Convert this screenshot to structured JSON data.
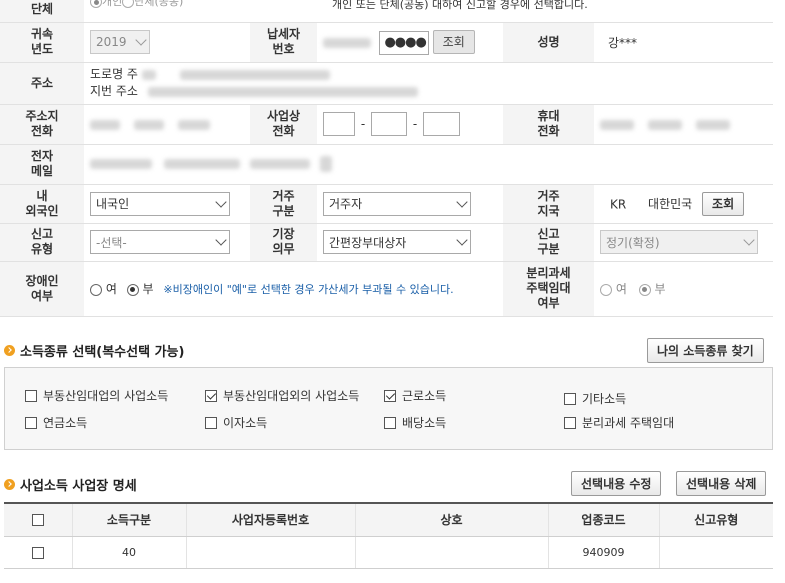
{
  "rows": {
    "group_type": {
      "label": "단체",
      "option_individual": "개인",
      "option_group": "단체(공동)",
      "note": "개인 또는 단체(공동) 대하여 신고할 경우에 선택합니다."
    },
    "tax_year": {
      "label": "귀속\n년도",
      "value": "2019"
    },
    "taxpayer_no": {
      "label": "납세자\n번호",
      "masked": "●●●●",
      "lookup_button": "조회"
    },
    "name": {
      "label": "성명",
      "value": "강***"
    },
    "address": {
      "label": "주소",
      "road_prefix": "도로명 주",
      "lot_prefix": "지번 주소"
    },
    "addr_phone": {
      "label": "주소지\n전화"
    },
    "biz_phone": {
      "label": "사업상\n전화",
      "sep": "-"
    },
    "mobile": {
      "label": "휴대\n전화"
    },
    "email": {
      "label": "전자\n메일"
    },
    "nationality": {
      "label": "내\n외국인",
      "value": "내국인"
    },
    "residency": {
      "label": "거주\n구분",
      "value": "거주자"
    },
    "residence_country": {
      "label": "거주\n지국",
      "code": "KR",
      "country": "대한민국",
      "lookup_button": "조회"
    },
    "report_type": {
      "label": "신고\n유형",
      "value": "-선택-"
    },
    "bookkeeping": {
      "label": "기장\n의무",
      "value": "간편장부대상자"
    },
    "report_category": {
      "label": "신고\n구분",
      "value": "정기(확정)"
    },
    "disabled": {
      "label": "장애인\n여부",
      "yes": "여",
      "no": "부",
      "note": "※비장애인이 \"예\"로 선택한 경우 가산세가 부과될 수 있습니다."
    },
    "separate_tax": {
      "label": "분리과세\n주택임대\n여부",
      "yes": "여",
      "no": "부"
    }
  },
  "income_section": {
    "title": "소득종류 선택(복수선택 가능)",
    "find_button": "나의 소득종류 찾기",
    "items": [
      {
        "label": "부동산임대업의 사업소득",
        "checked": false
      },
      {
        "label": "부동산임대업외의 사업소득",
        "checked": true
      },
      {
        "label": "근로소득",
        "checked": true
      },
      {
        "label": "기타소득",
        "checked": false
      },
      {
        "label": "연금소득",
        "checked": false
      },
      {
        "label": "이자소득",
        "checked": false
      },
      {
        "label": "배당소득",
        "checked": false
      },
      {
        "label": "분리과세 주택임대",
        "checked": false
      }
    ]
  },
  "biz_section": {
    "title": "사업소득 사업장 명세",
    "edit_button": "선택내용 수정",
    "delete_button": "선택내용 삭제",
    "columns": [
      "소득구분",
      "사업자등록번호",
      "상호",
      "업종코드",
      "신고유형"
    ],
    "rows": [
      {
        "income_type": "40",
        "biz_no": "",
        "trade_name": "",
        "industry_code": "940909",
        "report_type": ""
      }
    ]
  }
}
